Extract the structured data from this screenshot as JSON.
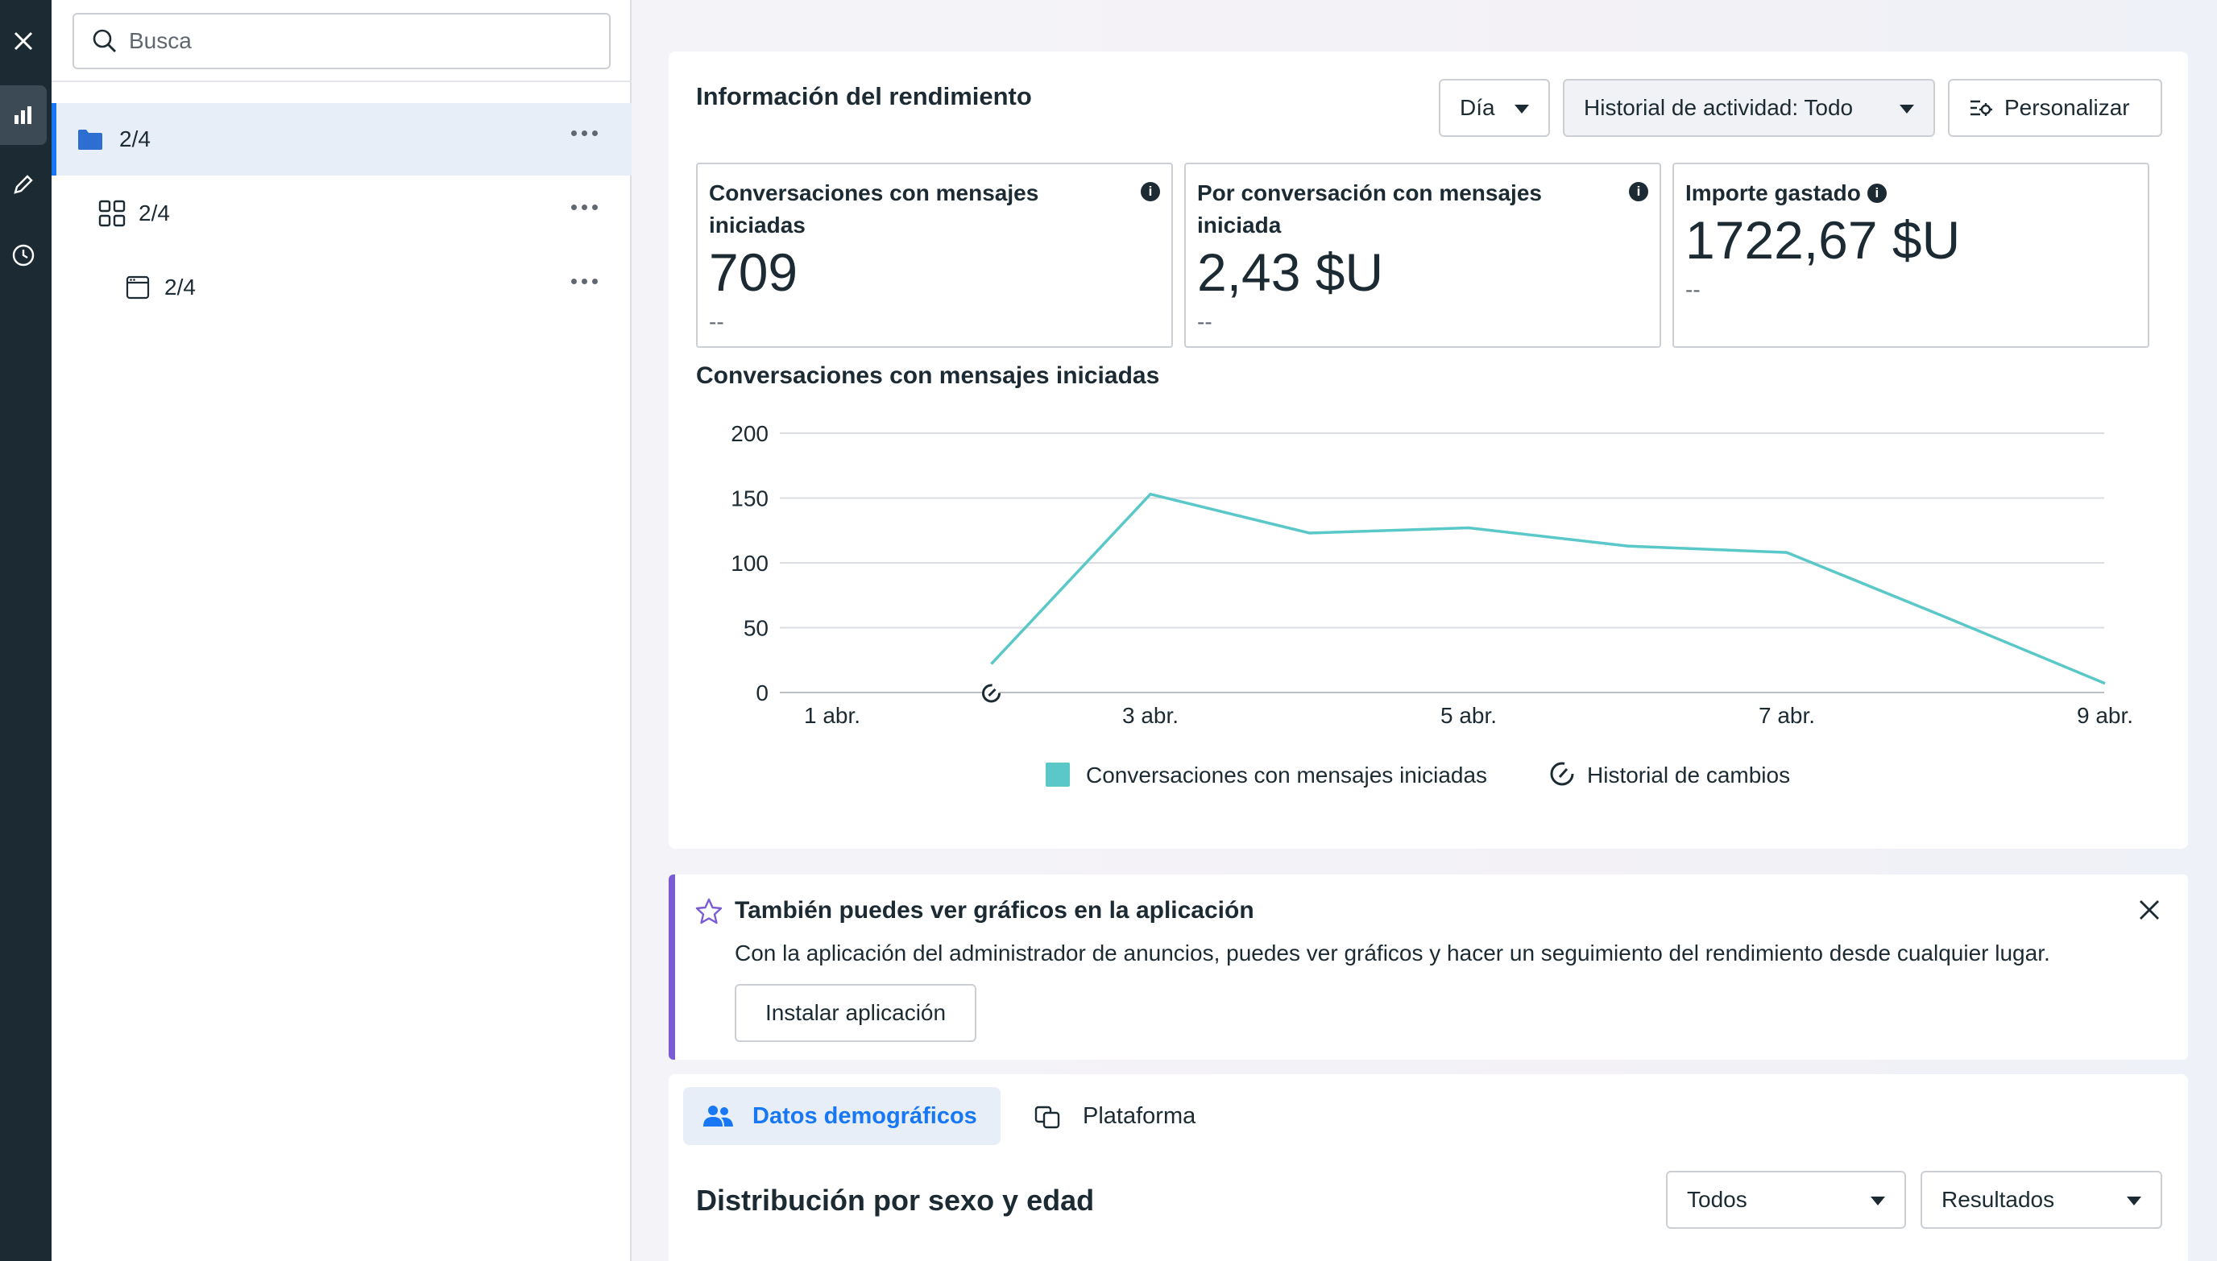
{
  "rail": {
    "icons": [
      "close-icon",
      "chart-icon",
      "pencil-icon",
      "clock-icon"
    ]
  },
  "sidebar": {
    "search_placeholder": "Busca",
    "items": [
      {
        "label": "2/4",
        "icon": "folder-icon"
      },
      {
        "label": "2/4",
        "icon": "grid-icon"
      },
      {
        "label": "2/4",
        "icon": "ad-icon"
      }
    ]
  },
  "performance": {
    "title": "Información del rendimiento",
    "filters": {
      "day": "Día",
      "activity": "Historial de actividad: Todo",
      "customize": "Personalizar"
    },
    "metrics": [
      {
        "label": "Conversaciones con mensajes iniciadas",
        "value": "709",
        "compare": "--"
      },
      {
        "label": "Por conversación con mensajes iniciada",
        "value": "2,43 $U",
        "compare": "--"
      },
      {
        "label": "Importe gastado",
        "value": "1722,67 $U",
        "compare": "--"
      }
    ],
    "chart_title": "Conversaciones con mensajes iniciadas",
    "legend": {
      "series": "Conversaciones con mensajes iniciadas",
      "changes": "Historial de cambios"
    }
  },
  "chart_data": {
    "type": "line",
    "title": "Conversaciones con mensajes iniciadas",
    "x": [
      "1 abr.",
      "2 abr.",
      "3 abr.",
      "4 abr.",
      "5 abr.",
      "6 abr.",
      "7 abr.",
      "8 abr.",
      "9 abr."
    ],
    "x_tick_labels": [
      "1 abr.",
      "3 abr.",
      "5 abr.",
      "7 abr.",
      "9 abr."
    ],
    "series": [
      {
        "name": "Conversaciones con mensajes iniciadas",
        "color": "#5ac8c8",
        "values": [
          null,
          22,
          153,
          123,
          127,
          113,
          108,
          58,
          7
        ]
      }
    ],
    "ylim": [
      0,
      200
    ],
    "y_ticks": [
      0,
      50,
      100,
      150,
      200
    ],
    "grid": true,
    "change_markers": [
      "2 abr."
    ],
    "legend_position": "bottom"
  },
  "banner": {
    "title": "También puedes ver gráficos en la aplicación",
    "text": "Con la aplicación del administrador de anuncios, puedes ver gráficos y hacer un seguimiento del rendimiento desde cualquier lugar.",
    "button": "Instalar aplicación"
  },
  "demographics": {
    "tabs": [
      "Datos demográficos",
      "Plataforma"
    ],
    "title": "Distribución por sexo y edad",
    "filter_all": "Todos",
    "filter_results": "Resultados"
  },
  "colors": {
    "accent": "#1877f2",
    "series": "#5ac8c8",
    "banner_accent": "#7a5cd6",
    "rail": "#1c2b33"
  }
}
